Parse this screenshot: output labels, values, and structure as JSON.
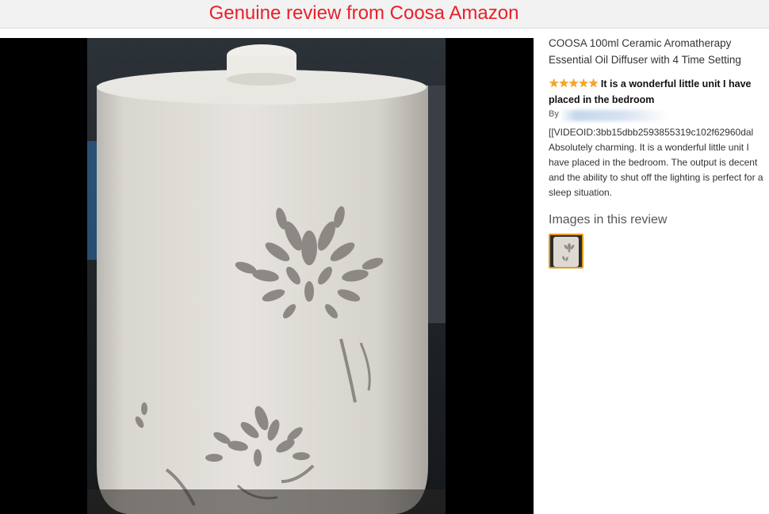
{
  "banner": {
    "title": "Genuine review from Coosa Amazon"
  },
  "product": {
    "title": "COOSA 100ml Ceramic Aromatherapy Essential Oil Diffuser with 4 Time Setting"
  },
  "review": {
    "star_count": 5,
    "rating_icon": "star-icon",
    "title": "It is a wonderful little unit I have placed in the bedroom",
    "by_label": "By",
    "video_id_text": "[[VIDEOID:3bb15dbb2593855319c102f62960dal",
    "body": "Absolutely charming. It is a wonderful little unit I have placed in the bedroom. The output is decent and the ability to shut off the lighting is perfect for a sleep situation."
  },
  "images_section": {
    "heading": "Images in this review"
  },
  "colors": {
    "banner_text": "#e8202a",
    "star": "#f6a623",
    "thumb_border": "#e49a1b"
  }
}
